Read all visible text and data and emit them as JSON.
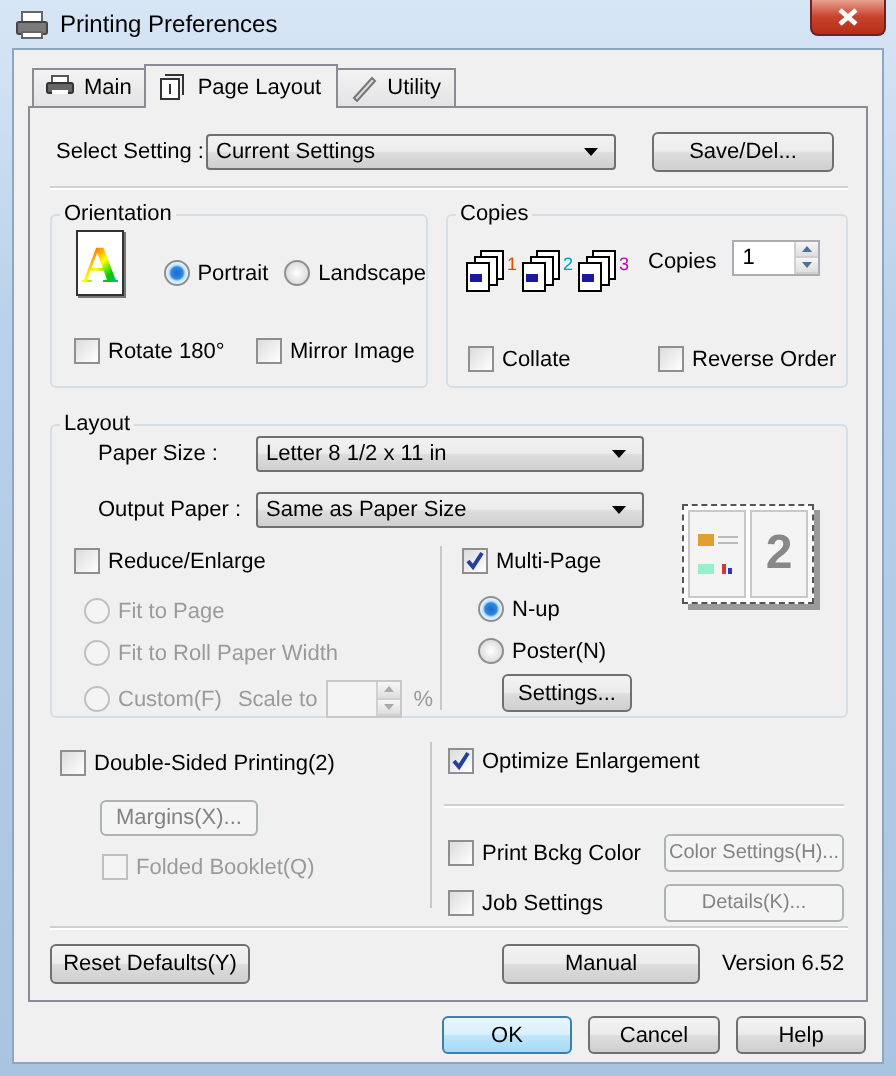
{
  "window": {
    "title": "Printing Preferences"
  },
  "tabs": [
    {
      "label": "Main",
      "selected": false
    },
    {
      "label": "Page Layout",
      "selected": true
    },
    {
      "label": "Utility",
      "selected": false
    }
  ],
  "select_setting": {
    "label": "Select Setting :",
    "value": "Current Settings",
    "button": "Save/Del..."
  },
  "orientation": {
    "title": "Orientation",
    "preview_letter": "A",
    "options": [
      {
        "label": "Portrait",
        "selected": true
      },
      {
        "label": "Landscape",
        "selected": false
      }
    ],
    "checkboxes": [
      {
        "label": "Rotate 180°",
        "checked": false
      },
      {
        "label": "Mirror Image",
        "checked": false
      }
    ]
  },
  "copies": {
    "title": "Copies",
    "stack_labels": [
      "1",
      "2",
      "3"
    ],
    "label": "Copies",
    "value": "1",
    "checkboxes": [
      {
        "label": "Collate",
        "checked": false
      },
      {
        "label": "Reverse Order",
        "checked": false
      }
    ]
  },
  "layout": {
    "title": "Layout",
    "paper_size": {
      "label": "Paper Size :",
      "value": "Letter 8 1/2 x 11 in"
    },
    "output_paper": {
      "label": "Output Paper :",
      "value": "Same as Paper Size"
    },
    "reduce_enlarge": {
      "label": "Reduce/Enlarge",
      "checked": false
    },
    "reduce_options": [
      {
        "label": "Fit to Page",
        "selected": false,
        "disabled": true
      },
      {
        "label": "Fit to Roll Paper Width",
        "selected": false,
        "disabled": true
      },
      {
        "label": "Custom(F)",
        "selected": false,
        "disabled": true
      }
    ],
    "scale": {
      "label": "Scale to",
      "unit": "%",
      "disabled": true
    },
    "multi_page": {
      "label": "Multi-Page",
      "checked": true
    },
    "multi_options": [
      {
        "label": "N-up",
        "selected": true
      },
      {
        "label": "Poster(N)",
        "selected": false
      }
    ],
    "settings_button": "Settings...",
    "preview_page": "2"
  },
  "double_sided": {
    "label": "Double-Sided Printing(2)",
    "checked": false
  },
  "margins_button": {
    "label": "Margins(X)...",
    "disabled": true
  },
  "folded_booklet": {
    "label": "Folded Booklet(Q)",
    "checked": false,
    "disabled": true
  },
  "optimize_enlargement": {
    "label": "Optimize Enlargement",
    "checked": true
  },
  "print_bckg_color": {
    "label": "Print Bckg Color",
    "checked": false
  },
  "color_settings_button": {
    "label": "Color Settings(H)...",
    "disabled": true
  },
  "job_settings": {
    "label": "Job Settings",
    "checked": false
  },
  "details_button": {
    "label": "Details(K)...",
    "disabled": true
  },
  "reset_button": "Reset Defaults(Y)",
  "manual_button": "Manual",
  "version": "Version 6.52",
  "dialog_buttons": [
    {
      "label": "OK",
      "default": true
    },
    {
      "label": "Cancel",
      "default": false
    },
    {
      "label": "Help",
      "default": false
    }
  ]
}
